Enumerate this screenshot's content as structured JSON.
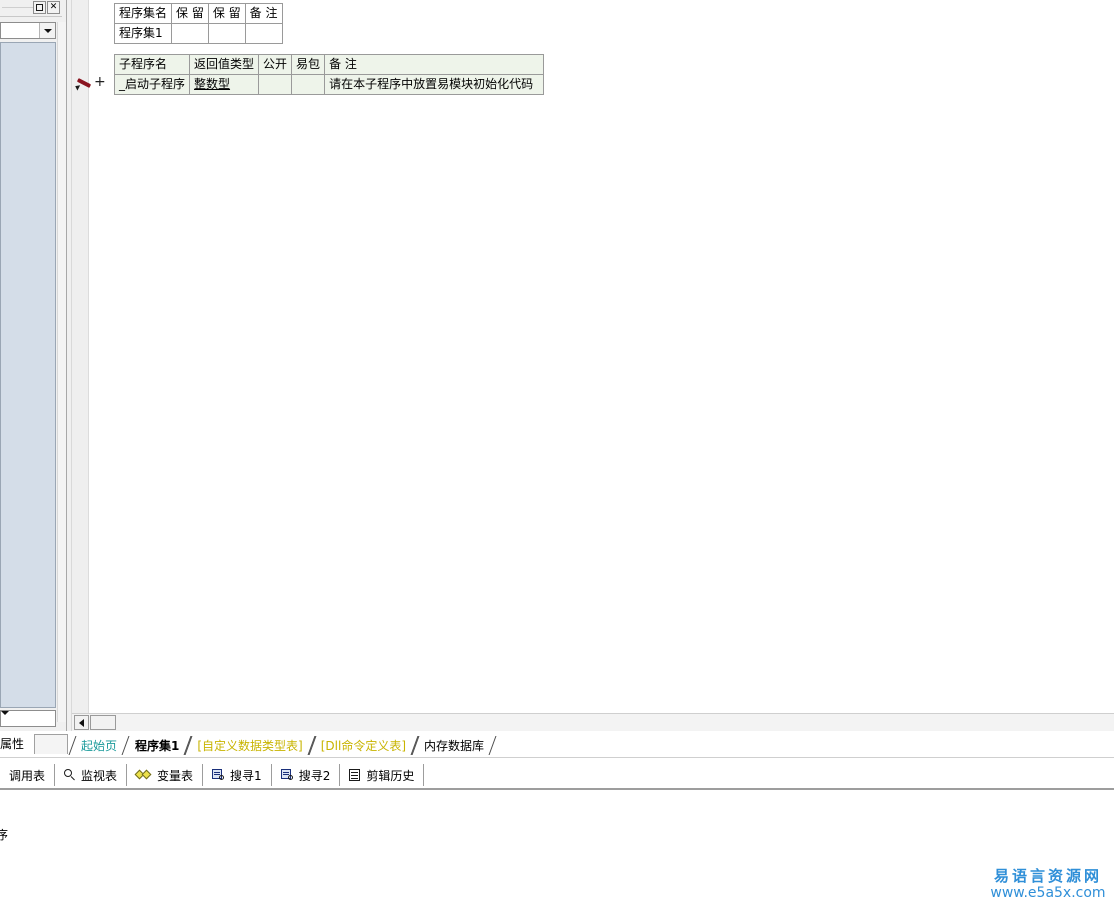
{
  "window": {
    "maximize_label": "□",
    "close_label": "✕"
  },
  "property_panel": {
    "title": "",
    "combo_value": "",
    "bottom_combo_value": ""
  },
  "editor": {
    "marker_icon": "pencil-icon",
    "add_label": "+",
    "program_table": {
      "headers": [
        "程序集名",
        "保 留",
        "保 留",
        "备 注"
      ],
      "rows": [
        [
          "程序集1",
          "",
          "",
          ""
        ]
      ]
    },
    "sub_table": {
      "headers": [
        "子程序名",
        "返回值类型",
        "公开",
        "易包",
        "备 注"
      ],
      "rows": [
        {
          "name": "_启动子程序",
          "return_type": "整数型",
          "public": "",
          "package": "",
          "note": "请在本子程序中放置易模块初始化代码"
        }
      ]
    }
  },
  "scrollbars": {
    "left_arrow_glyph": "◄",
    "up_arrow_glyph": "▲",
    "down_arrow_glyph": "▼"
  },
  "doc_tabs": {
    "property_label": "属性",
    "items": [
      {
        "label": "起始页",
        "style": "teal",
        "active": false
      },
      {
        "label": "程序集1",
        "style": "active",
        "active": true
      },
      {
        "label": "[自定义数据类型表]",
        "style": "olive",
        "active": false
      },
      {
        "label": "[Dll命令定义表]",
        "style": "olive",
        "active": false
      },
      {
        "label": "内存数据库",
        "style": "black",
        "active": false
      }
    ]
  },
  "bottom_tabs": {
    "items": [
      {
        "label": "调用表",
        "icon": "none"
      },
      {
        "label": "监视表",
        "icon": "magnifier-icon"
      },
      {
        "label": "变量表",
        "icon": "diamonds-icon"
      },
      {
        "label": "搜寻1",
        "icon": "find-icon"
      },
      {
        "label": "搜寻2",
        "icon": "find-icon"
      },
      {
        "label": "剪辑历史",
        "icon": "clipboard-icon"
      }
    ]
  },
  "output_pane": {
    "text": "序"
  },
  "watermark": {
    "site_cn": "易语言资源网",
    "site_url": "www.e5a5x.com"
  },
  "colors": {
    "panel_blue": "#d4dde8",
    "sub_table_bg": "#eef4ea",
    "type_link": "#0000c8",
    "note_green": "#1c6b1c",
    "tab_teal": "#1a9a9a",
    "tab_olive": "#c8b400",
    "watermark_blue": "#2f8fd8"
  }
}
